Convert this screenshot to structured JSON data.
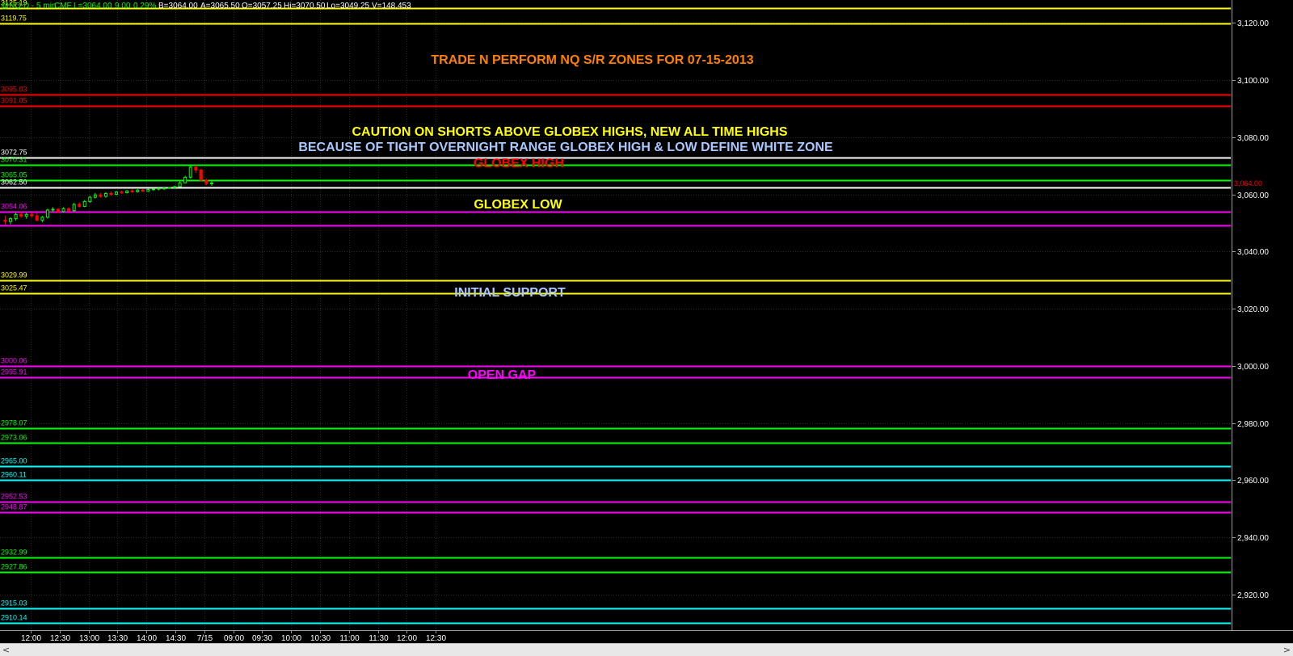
{
  "header": {
    "symbol": "@NQ.D - 5 min",
    "exchange": "CME",
    "last": "L=3064.00",
    "change": "9.00",
    "change_pct": "0.29%",
    "bid": "B=3064.00",
    "ask": "A=3065.50",
    "open": "O=3057.25",
    "high": "Hi=3070.50",
    "low": "Lo=3049.25",
    "volume": "V=148,453",
    "color": "#00ff00"
  },
  "annotations": [
    {
      "text": "TRADE N PERFORM NQ S/R ZONES FOR 07-15-2013",
      "color": "#ff8000"
    },
    {
      "text": "CAUTION ON SHORTS ABOVE GLOBEX HIGHS, NEW ALL TIME HIGHS",
      "color": "#ffff00"
    },
    {
      "text": "BECAUSE OF TIGHT OVERNIGHT RANGE GLOBEX HIGH & LOW  DEFINE WHITE ZONE",
      "color": "#a8c8ff"
    },
    {
      "text": "GLOBEX HIGH",
      "color": "#ff0000"
    },
    {
      "text": "GLOBEX LOW",
      "color": "#ffff00"
    },
    {
      "text": "INITIAL SUPPORT",
      "color": "#a8c8ff"
    },
    {
      "text": "OPEN GAP",
      "color": "#ff00ff"
    }
  ],
  "scrollbar": {
    "left_arrow": "<",
    "right_arrow": ">"
  },
  "chart_data": {
    "type": "candlestick",
    "title": "TRADE N PERFORM NQ S/R ZONES FOR 07-15-2013",
    "ylim": [
      2903,
      3128
    ],
    "grid": true,
    "y_ticks": [
      "3,120.00",
      "3,100.00",
      "3,080.00",
      "3,060.00",
      "3,040.00",
      "3,020.00",
      "3,000.00",
      "2,980.00",
      "2,960.00",
      "2,940.00",
      "2,920.00"
    ],
    "y_tick_values": [
      3120,
      3100,
      3080,
      3060,
      3040,
      3020,
      3000,
      2980,
      2960,
      2940,
      2920
    ],
    "x_ticks": [
      "12:00",
      "12:30",
      "13:00",
      "13:30",
      "14:00",
      "14:30",
      "7/15",
      "09:00",
      "09:30",
      "10:00",
      "10:30",
      "11:00",
      "11:30",
      "12:00",
      "12:30"
    ],
    "last_price": {
      "value": 3064.0,
      "label": "3,064.00",
      "color": "#ff0000"
    },
    "levels": [
      {
        "label": "3125.19",
        "value": 3125.19,
        "color": "#ffff00"
      },
      {
        "label": "3119.75",
        "value": 3119.75,
        "color": "#ffff00"
      },
      {
        "label": "3095.03",
        "value": 3095.03,
        "color": "#ff0000"
      },
      {
        "label": "3091.05",
        "value": 3091.05,
        "color": "#ff0000"
      },
      {
        "label": "3072.75",
        "value": 3072.75,
        "color": "#ffffff"
      },
      {
        "label": "3070.31",
        "value": 3070.31,
        "color": "#00ff00"
      },
      {
        "label": "3065.05",
        "value": 3065.05,
        "color": "#00ff00"
      },
      {
        "label": "3062.50",
        "value": 3062.5,
        "color": "#ffffff"
      },
      {
        "label": "3054.06",
        "value": 3054.06,
        "color": "#ff00ff"
      },
      {
        "label": "3049.00",
        "value": 3049.0,
        "color": "#ff00ff",
        "show_label": false
      },
      {
        "label": "3029.99",
        "value": 3029.99,
        "color": "#ffff00"
      },
      {
        "label": "3025.47",
        "value": 3025.47,
        "color": "#ffff00"
      },
      {
        "label": "3000.06",
        "value": 3000.06,
        "color": "#ff00ff"
      },
      {
        "label": "2995.91",
        "value": 2995.91,
        "color": "#ff00ff"
      },
      {
        "label": "2978.07",
        "value": 2978.07,
        "color": "#00ff00"
      },
      {
        "label": "2973.06",
        "value": 2973.06,
        "color": "#00ff00"
      },
      {
        "label": "2965.00",
        "value": 2965.0,
        "color": "#00ffff"
      },
      {
        "label": "2960.11",
        "value": 2960.11,
        "color": "#00ffff"
      },
      {
        "label": "2952.53",
        "value": 2952.53,
        "color": "#ff00ff"
      },
      {
        "label": "2948.87",
        "value": 2948.87,
        "color": "#ff00ff"
      },
      {
        "label": "2932.99",
        "value": 2932.99,
        "color": "#00ff00"
      },
      {
        "label": "2927.86",
        "value": 2927.86,
        "color": "#00ff00"
      },
      {
        "label": "2915.03",
        "value": 2915.03,
        "color": "#00ffff"
      },
      {
        "label": "2910.14",
        "value": 2910.14,
        "color": "#00ffff"
      }
    ],
    "candles": [
      {
        "o": 3051.0,
        "h": 3052.5,
        "l": 3049.3,
        "c": 3050.5
      },
      {
        "o": 3050.5,
        "h": 3052.0,
        "l": 3049.5,
        "c": 3051.5
      },
      {
        "o": 3051.5,
        "h": 3053.5,
        "l": 3050.8,
        "c": 3053.0
      },
      {
        "o": 3053.0,
        "h": 3054.0,
        "l": 3051.8,
        "c": 3052.3
      },
      {
        "o": 3052.3,
        "h": 3053.5,
        "l": 3051.5,
        "c": 3053.0
      },
      {
        "o": 3053.0,
        "h": 3053.8,
        "l": 3051.8,
        "c": 3052.5
      },
      {
        "o": 3052.5,
        "h": 3053.5,
        "l": 3050.5,
        "c": 3051.0
      },
      {
        "o": 3051.0,
        "h": 3052.5,
        "l": 3050.2,
        "c": 3052.0
      },
      {
        "o": 3052.0,
        "h": 3055.0,
        "l": 3051.5,
        "c": 3054.5
      },
      {
        "o": 3054.5,
        "h": 3055.5,
        "l": 3053.8,
        "c": 3054.8
      },
      {
        "o": 3054.8,
        "h": 3055.2,
        "l": 3053.5,
        "c": 3054.0
      },
      {
        "o": 3054.0,
        "h": 3055.5,
        "l": 3053.5,
        "c": 3055.0
      },
      {
        "o": 3055.0,
        "h": 3055.5,
        "l": 3054.0,
        "c": 3054.3
      },
      {
        "o": 3054.3,
        "h": 3057.0,
        "l": 3054.0,
        "c": 3056.5
      },
      {
        "o": 3056.5,
        "h": 3057.2,
        "l": 3055.3,
        "c": 3055.8
      },
      {
        "o": 3055.8,
        "h": 3058.0,
        "l": 3055.5,
        "c": 3057.5
      },
      {
        "o": 3057.5,
        "h": 3059.5,
        "l": 3057.0,
        "c": 3059.0
      },
      {
        "o": 3059.0,
        "h": 3060.5,
        "l": 3058.5,
        "c": 3059.8
      },
      {
        "o": 3059.8,
        "h": 3060.5,
        "l": 3058.8,
        "c": 3059.3
      },
      {
        "o": 3059.3,
        "h": 3060.8,
        "l": 3058.8,
        "c": 3060.3
      },
      {
        "o": 3060.3,
        "h": 3061.0,
        "l": 3059.5,
        "c": 3060.0
      },
      {
        "o": 3060.0,
        "h": 3061.2,
        "l": 3059.8,
        "c": 3060.8
      },
      {
        "o": 3060.8,
        "h": 3061.3,
        "l": 3060.2,
        "c": 3060.6
      },
      {
        "o": 3060.6,
        "h": 3061.5,
        "l": 3060.3,
        "c": 3061.2
      },
      {
        "o": 3061.2,
        "h": 3061.8,
        "l": 3060.5,
        "c": 3060.9
      },
      {
        "o": 3060.9,
        "h": 3061.8,
        "l": 3060.6,
        "c": 3061.5
      },
      {
        "o": 3061.5,
        "h": 3061.9,
        "l": 3060.8,
        "c": 3061.1
      },
      {
        "o": 3061.1,
        "h": 3062.0,
        "l": 3060.9,
        "c": 3061.7
      },
      {
        "o": 3061.7,
        "h": 3062.2,
        "l": 3061.2,
        "c": 3061.9
      },
      {
        "o": 3061.9,
        "h": 3062.3,
        "l": 3061.4,
        "c": 3062.1
      },
      {
        "o": 3062.1,
        "h": 3062.4,
        "l": 3061.6,
        "c": 3062.2
      },
      {
        "o": 3062.2,
        "h": 3062.6,
        "l": 3061.9,
        "c": 3062.4
      },
      {
        "o": 3062.4,
        "h": 3063.0,
        "l": 3062.1,
        "c": 3062.7
      },
      {
        "o": 3062.7,
        "h": 3064.5,
        "l": 3062.5,
        "c": 3064.0
      },
      {
        "o": 3064.0,
        "h": 3066.5,
        "l": 3063.8,
        "c": 3066.0
      },
      {
        "o": 3066.0,
        "h": 3070.5,
        "l": 3065.5,
        "c": 3069.5
      },
      {
        "o": 3069.5,
        "h": 3070.2,
        "l": 3067.5,
        "c": 3068.5
      },
      {
        "o": 3068.5,
        "h": 3069.0,
        "l": 3064.5,
        "c": 3065.0
      },
      {
        "o": 3065.0,
        "h": 3065.5,
        "l": 3063.2,
        "c": 3063.8
      },
      {
        "o": 3063.8,
        "h": 3064.5,
        "l": 3063.0,
        "c": 3064.0
      }
    ]
  }
}
